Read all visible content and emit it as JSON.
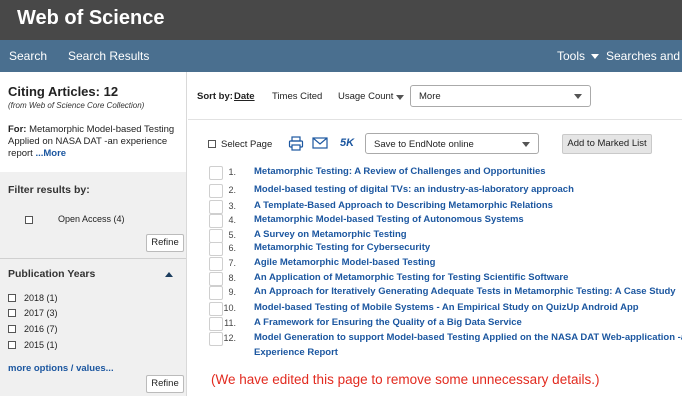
{
  "header": {
    "logo": "Web of Science"
  },
  "nav": {
    "search": "Search",
    "search_results": "Search Results",
    "tools": "Tools",
    "searches_and_alerts": "Searches and ale"
  },
  "sidebar": {
    "citing_title": "Citing Articles: 12",
    "citing_sub": "(from Web of Science Core Collection)",
    "for_label": "For:",
    "for_text": "Metamorphic Model-based Testing Applied on NASA DAT -an experience report",
    "for_more": "...More",
    "filter_label": "Filter results by:",
    "open_access": "Open Access (4)",
    "refine_label": "Refine",
    "pub_years_label": "Publication Years",
    "years": [
      "2018 (1)",
      "2017 (3)",
      "2016 (7)",
      "2015 (1)"
    ],
    "more_options": "more options / values..."
  },
  "sortbar": {
    "sort_by": "Sort by:",
    "date": "Date",
    "times_cited": "Times Cited",
    "usage_count": "Usage Count",
    "more_select": "More"
  },
  "toolbar": {
    "select_page": "Select Page",
    "fivek": "5K",
    "save_select": "Save to EndNote online",
    "add_marked": "Add to Marked List"
  },
  "results": [
    {
      "num": "1.",
      "title": "Metamorphic Testing: A Review of Challenges and Opportunities"
    },
    {
      "num": "2.",
      "title": "Model-based testing of digital TVs: an industry-as-laboratory approach"
    },
    {
      "num": "3.",
      "title": "A Template-Based Approach to Describing Metamorphic Relations"
    },
    {
      "num": "4.",
      "title": "Metamorphic Model-based Testing of Autonomous Systems"
    },
    {
      "num": "5.",
      "title": "A Survey on Metamorphic Testing"
    },
    {
      "num": "6.",
      "title": "Metamorphic Testing for Cybersecurity"
    },
    {
      "num": "7.",
      "title": "Agile Metamorphic Model-based Testing"
    },
    {
      "num": "8.",
      "title": "An Application of Metamorphic Testing for Testing Scientific Software"
    },
    {
      "num": "9.",
      "title": "An Approach for Iteratively Generating Adequate Tests in Metamorphic Testing: A Case Study"
    },
    {
      "num": "10.",
      "title": "Model-based Testing of Mobile Systems - An Empirical Study on QuizUp Android App"
    },
    {
      "num": "11.",
      "title": "A Framework for Ensuring the Quality of a Big Data Service"
    },
    {
      "num": "12.",
      "title": "Model Generation to support Model-based Testing Applied on the NASA DAT Web-application -an",
      "title_line2": "Experience Report"
    }
  ],
  "notice": "(We have edited this page to remove some unnecessary details.)"
}
